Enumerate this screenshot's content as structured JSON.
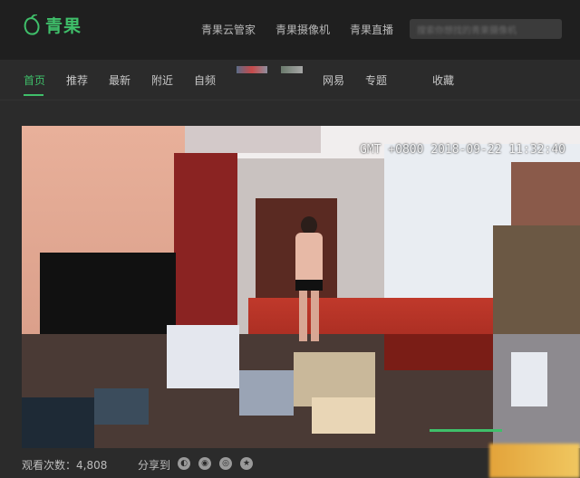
{
  "brand": {
    "name": "青果",
    "accent": "#3fbf6a"
  },
  "top_nav": [
    "青果云管家",
    "青果摄像机",
    "青果直播"
  ],
  "search": {
    "placeholder": "搜索你想找的青果摄像机"
  },
  "tabs": [
    {
      "label": "首页",
      "active": true
    },
    {
      "label": "推荐",
      "active": false
    },
    {
      "label": "最新",
      "active": false
    },
    {
      "label": "附近",
      "active": false
    },
    {
      "label": "自频",
      "active": false
    },
    {
      "label": "网易",
      "active": false
    },
    {
      "label": "专题",
      "active": false
    },
    {
      "label": "收藏",
      "active": false
    }
  ],
  "video": {
    "timestamp": "GMT +0800 2018-09-22 11:32:40"
  },
  "footer": {
    "view_count_label": "观看次数：4,808",
    "share_label": "分享到",
    "share_icons": [
      "wechat-icon",
      "qq-icon",
      "weibo-icon",
      "qzone-icon"
    ]
  }
}
